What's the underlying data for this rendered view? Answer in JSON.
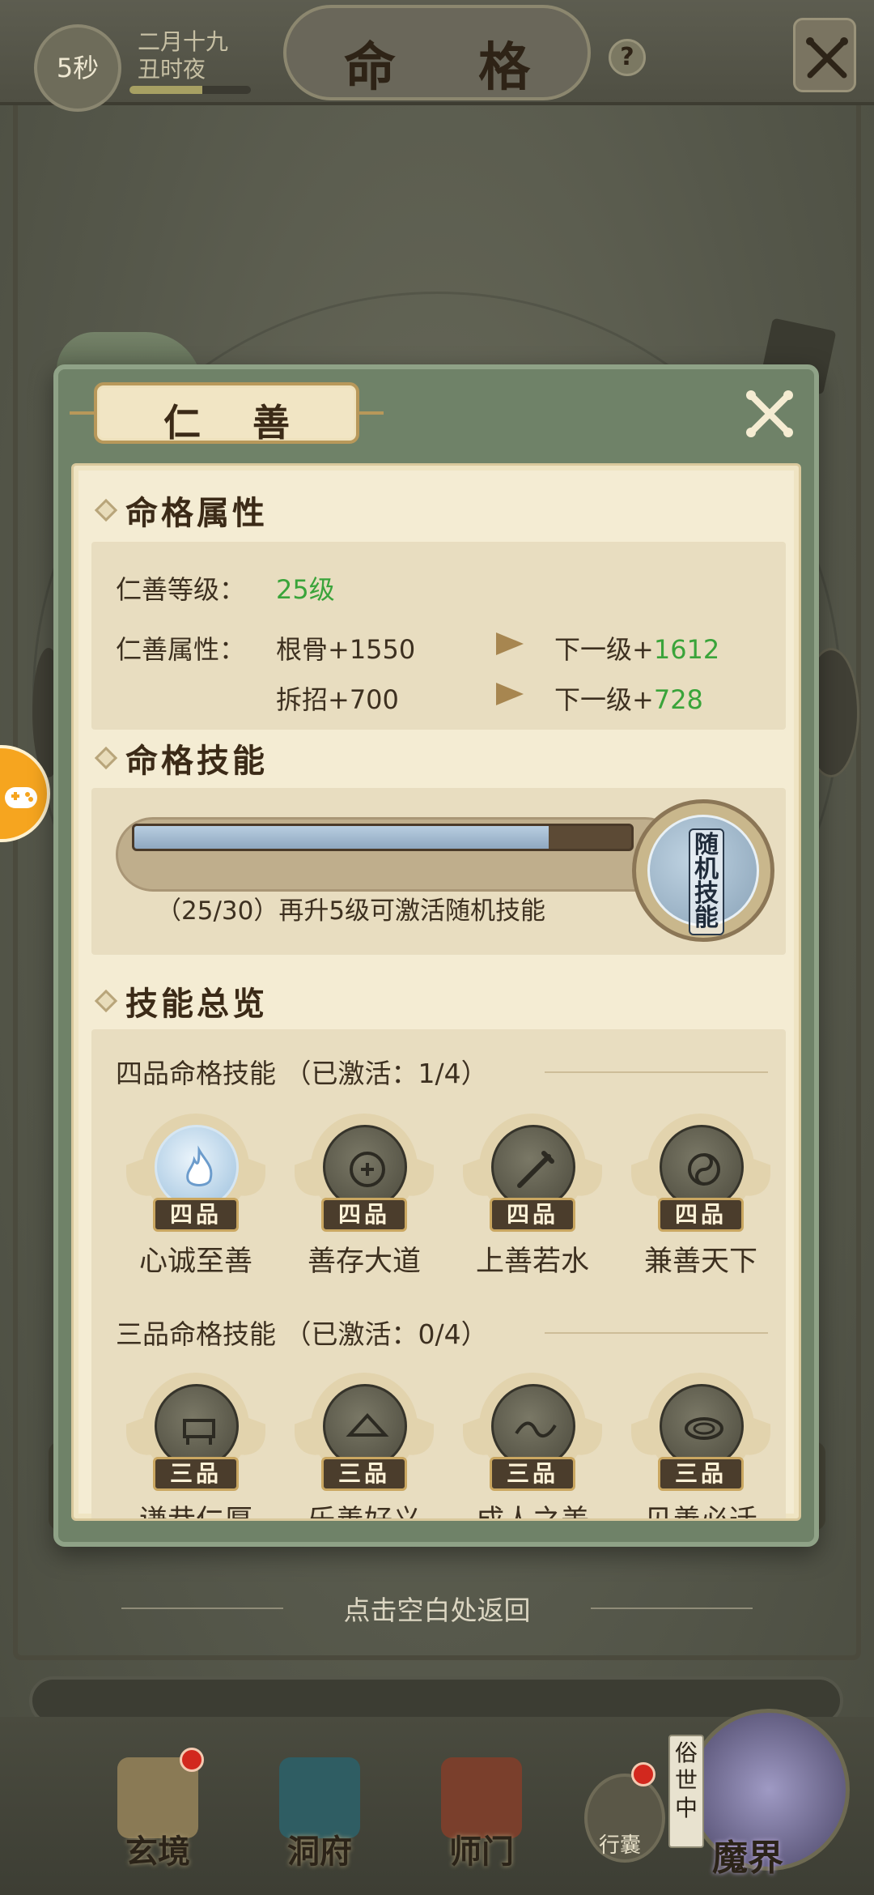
{
  "topbar": {
    "timer": "5秒",
    "date_line1": "二月十九",
    "date_line2": "丑时夜",
    "date_progress": 0.6,
    "title": "命 格",
    "help": "?"
  },
  "modal": {
    "title": "仁 善",
    "sections": {
      "attributes": "命格属性",
      "skills": "命格技能",
      "overview": "技能总览"
    },
    "level_label": "仁善等级：",
    "level_value": "25级",
    "attr_label": "仁善属性：",
    "attrs": [
      {
        "current": "根骨+1550",
        "next_prefix": "下一级+",
        "next_value": "1612"
      },
      {
        "current": "拆招+700",
        "next_prefix": "下一级+",
        "next_value": "728"
      }
    ],
    "progress": {
      "current": 25,
      "max": 30,
      "text": "（25/30）再升5级可激活随机技能",
      "badge": [
        "随",
        "机",
        "技",
        "能"
      ]
    },
    "tiers": [
      {
        "title": "四品命格技能",
        "status": "（已激活：1/4）",
        "grade": "四品",
        "skills": [
          {
            "name": "心诚至善",
            "active": true
          },
          {
            "name": "善存大道",
            "active": false
          },
          {
            "name": "上善若水",
            "active": false
          },
          {
            "name": "兼善天下",
            "active": false
          }
        ]
      },
      {
        "title": "三品命格技能",
        "status": "（已激活：0/4）",
        "grade": "三品",
        "skills": [
          {
            "name": "谦恭仁厚",
            "active": false
          },
          {
            "name": "乐善好义",
            "active": false
          },
          {
            "name": "成人之美",
            "active": false
          },
          {
            "name": "见善必迁",
            "active": false
          }
        ]
      }
    ]
  },
  "return_hint": "点击空白处返回",
  "nav": {
    "items": [
      {
        "label": "玄境",
        "badge": true
      },
      {
        "label": "洞府",
        "badge": false
      },
      {
        "label": "师门",
        "badge": false
      }
    ],
    "bag_label": "行囊",
    "moshi_tag": "俗世中",
    "moshi_label": "魔界"
  },
  "colors": {
    "accent_green": "#3aa43a",
    "modal_frame": "#6f8268",
    "paper": "#f4ecd3"
  }
}
